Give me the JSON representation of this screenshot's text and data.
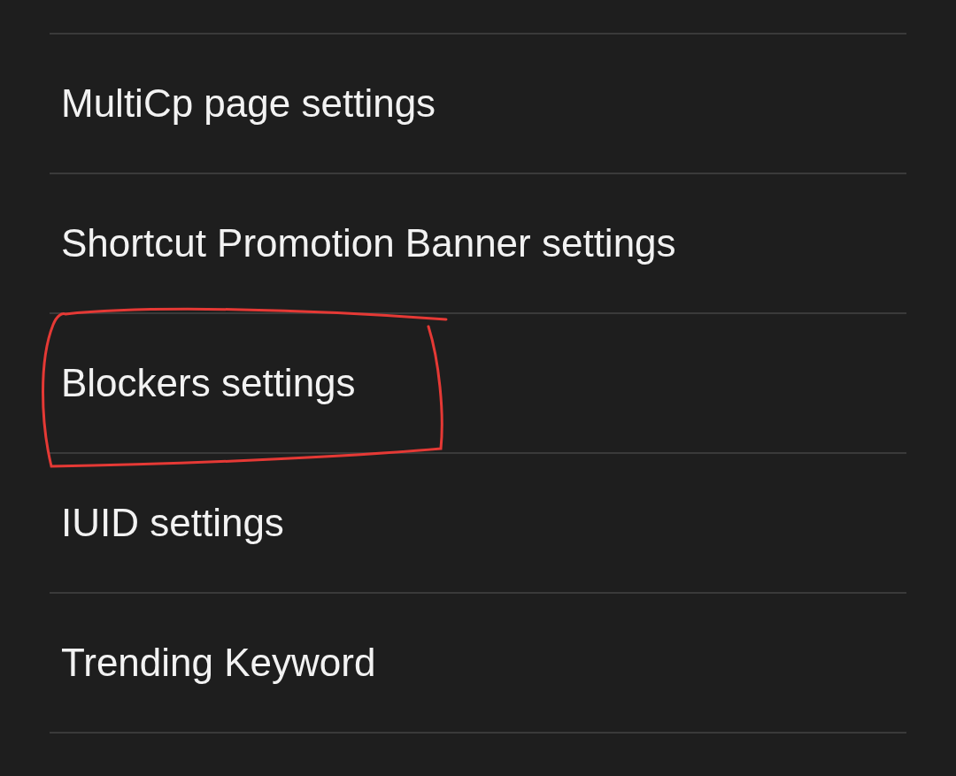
{
  "settings_items": [
    {
      "label": "MultiCp page settings",
      "annotated": false
    },
    {
      "label": "Shortcut Promotion Banner settings",
      "annotated": false
    },
    {
      "label": "Blockers settings",
      "annotated": true
    },
    {
      "label": "IUID settings",
      "annotated": false
    },
    {
      "label": "Trending Keyword",
      "annotated": false
    }
  ]
}
